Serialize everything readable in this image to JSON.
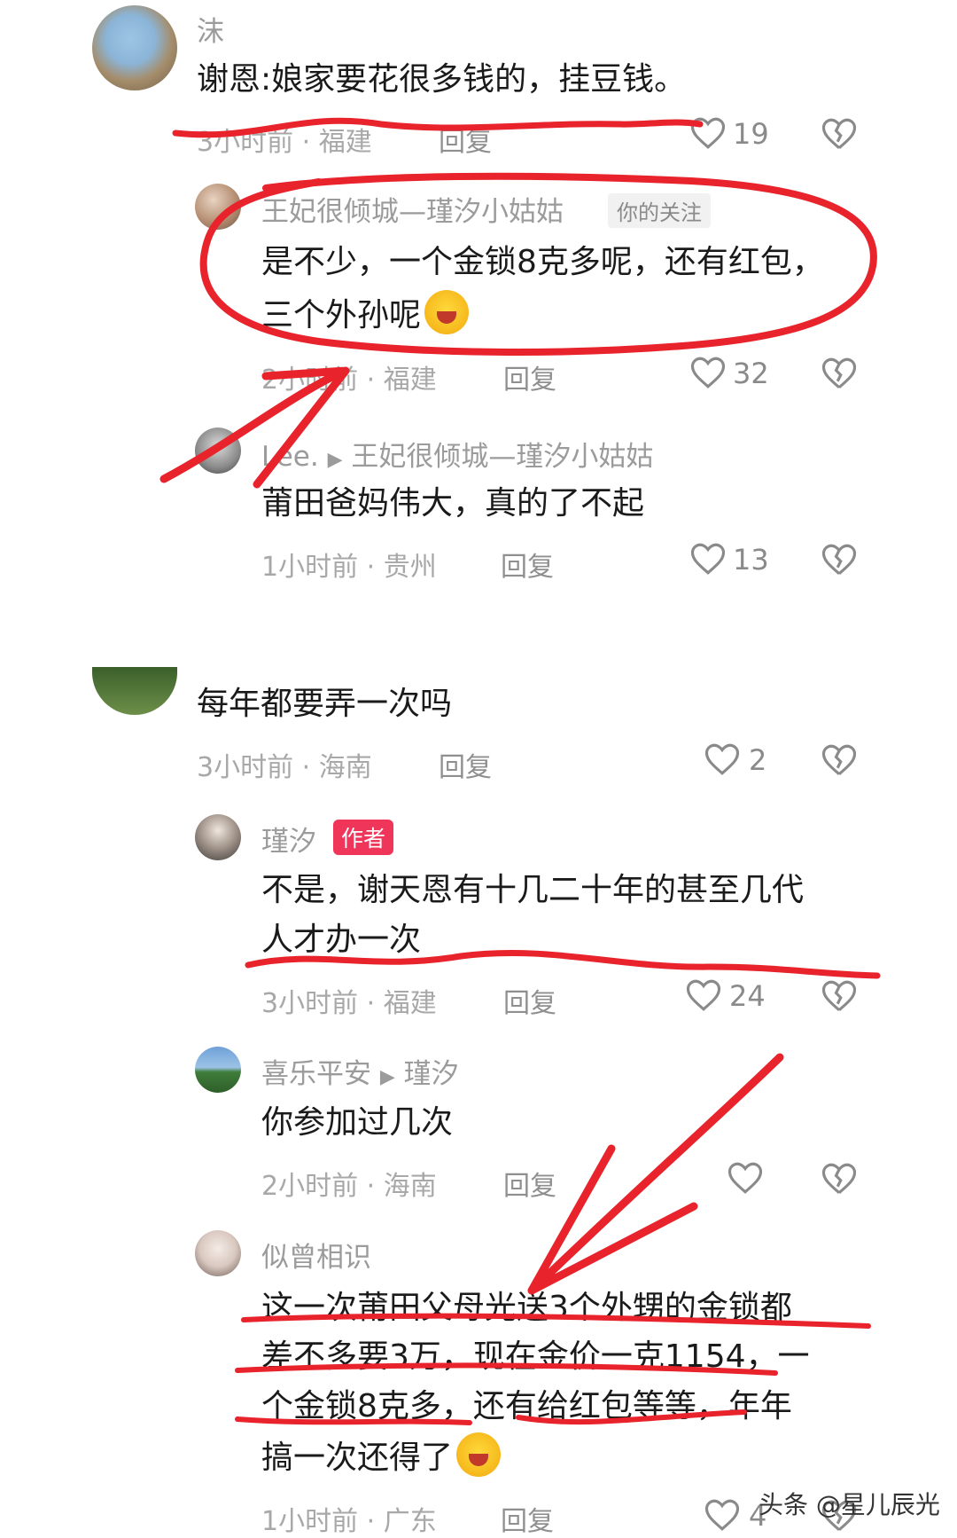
{
  "comments": [
    {
      "username": "沫",
      "text": "谢恩:娘家要花很多钱的，挂豆钱。",
      "time_location": "3小时前 · 福建",
      "reply": "回复",
      "likes": "19"
    },
    {
      "username": "王妃很倾城—瑾汐小姑姑",
      "tag": "你的关注",
      "text_line1": "是不少，一个金锁8克多呢，还有红包，",
      "text_line2": "三个外孙呢",
      "time_location": "2小时前 · 福建",
      "reply": "回复",
      "likes": "32"
    },
    {
      "username": "Lee.",
      "reply_to": "王妃很倾城—瑾汐小姑姑",
      "text": "莆田爸妈伟大，真的了不起",
      "time_location": "1小时前 · 贵州",
      "reply": "回复",
      "likes": "13"
    },
    {
      "text": "每年都要弄一次吗",
      "time_location": "3小时前 · 海南",
      "reply": "回复",
      "likes": "2"
    },
    {
      "username": "瑾汐",
      "tag": "作者",
      "text_line1": "不是，谢天恩有十几二十年的甚至几代",
      "text_line2": "人才办一次",
      "time_location": "3小时前 · 福建",
      "reply": "回复",
      "likes": "24"
    },
    {
      "username": "喜乐平安",
      "reply_to": "瑾汐",
      "text": "你参加过几次",
      "time_location": "2小时前 · 海南",
      "reply": "回复"
    },
    {
      "username": "似曾相识",
      "text_line1": "这一次莆田父母光送3个外甥的金锁都",
      "text_line2": "差不多要3万，现在金价一克1154，一",
      "text_line3": "个金锁8克多，还有给红包等等，年年",
      "text_line4": "搞一次还得了",
      "time_location": "1小时前 · 广东",
      "reply": "回复",
      "likes": "4"
    }
  ],
  "watermark": "头条 @星儿辰光",
  "colors": {
    "annotation_red": "#e8232b",
    "author_tag": "#f0355b"
  },
  "icons": [
    "heart-icon",
    "dislike-icon",
    "reply-arrow-icon",
    "laugh-cry-emoji"
  ]
}
